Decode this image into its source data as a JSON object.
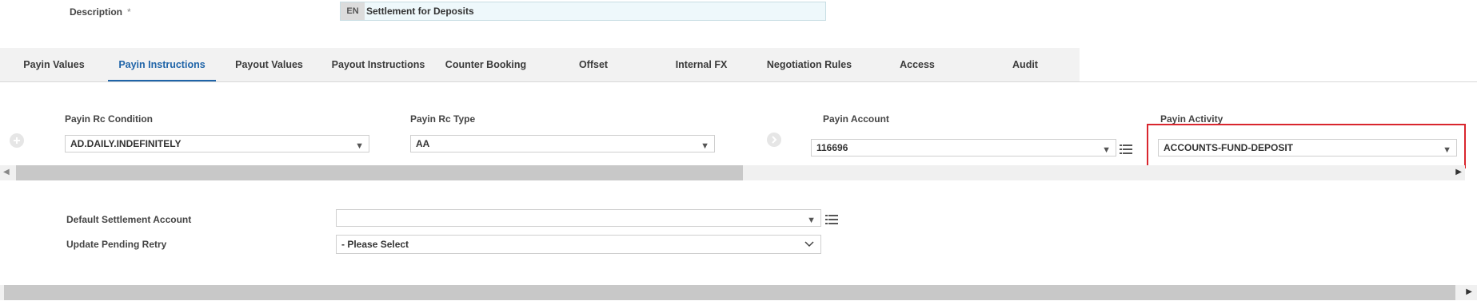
{
  "description": {
    "label": "Description",
    "required_mark": "*",
    "lang": "EN",
    "value": "Settlement for Deposits"
  },
  "tabs": [
    {
      "label": "Payin Values",
      "active": false
    },
    {
      "label": "Payin Instructions",
      "active": true
    },
    {
      "label": "Payout Values",
      "active": false
    },
    {
      "label": "Payout Instructions",
      "active": false
    },
    {
      "label": "Counter Booking",
      "active": false
    },
    {
      "label": "Offset",
      "active": false
    },
    {
      "label": "Internal FX",
      "active": false
    },
    {
      "label": "Negotiation Rules",
      "active": false
    },
    {
      "label": "Access",
      "active": false
    },
    {
      "label": "Audit",
      "active": false
    }
  ],
  "payin": {
    "rc_condition": {
      "label": "Payin Rc Condition",
      "value": "AD.DAILY.INDEFINITELY"
    },
    "rc_type": {
      "label": "Payin Rc Type",
      "value": "AA"
    },
    "account": {
      "label": "Payin Account",
      "value": "116696"
    },
    "activity": {
      "label": "Payin Activity",
      "value": "ACCOUNTS-FUND-DEPOSIT"
    }
  },
  "settlement": {
    "default_account": {
      "label": "Default Settlement Account",
      "value": ""
    },
    "pending_retry": {
      "label": "Update Pending Retry",
      "value": "- Please Select"
    }
  },
  "icons": {
    "add": "plus-circle-icon",
    "next": "arrow-circle-icon",
    "caret": "triangle-down-icon",
    "chevron": "chevron-down-icon",
    "list": "list-icon"
  },
  "colors": {
    "active_tab": "#1f64a8",
    "highlight": "#d9262e",
    "description_bg": "#eef8fb"
  }
}
